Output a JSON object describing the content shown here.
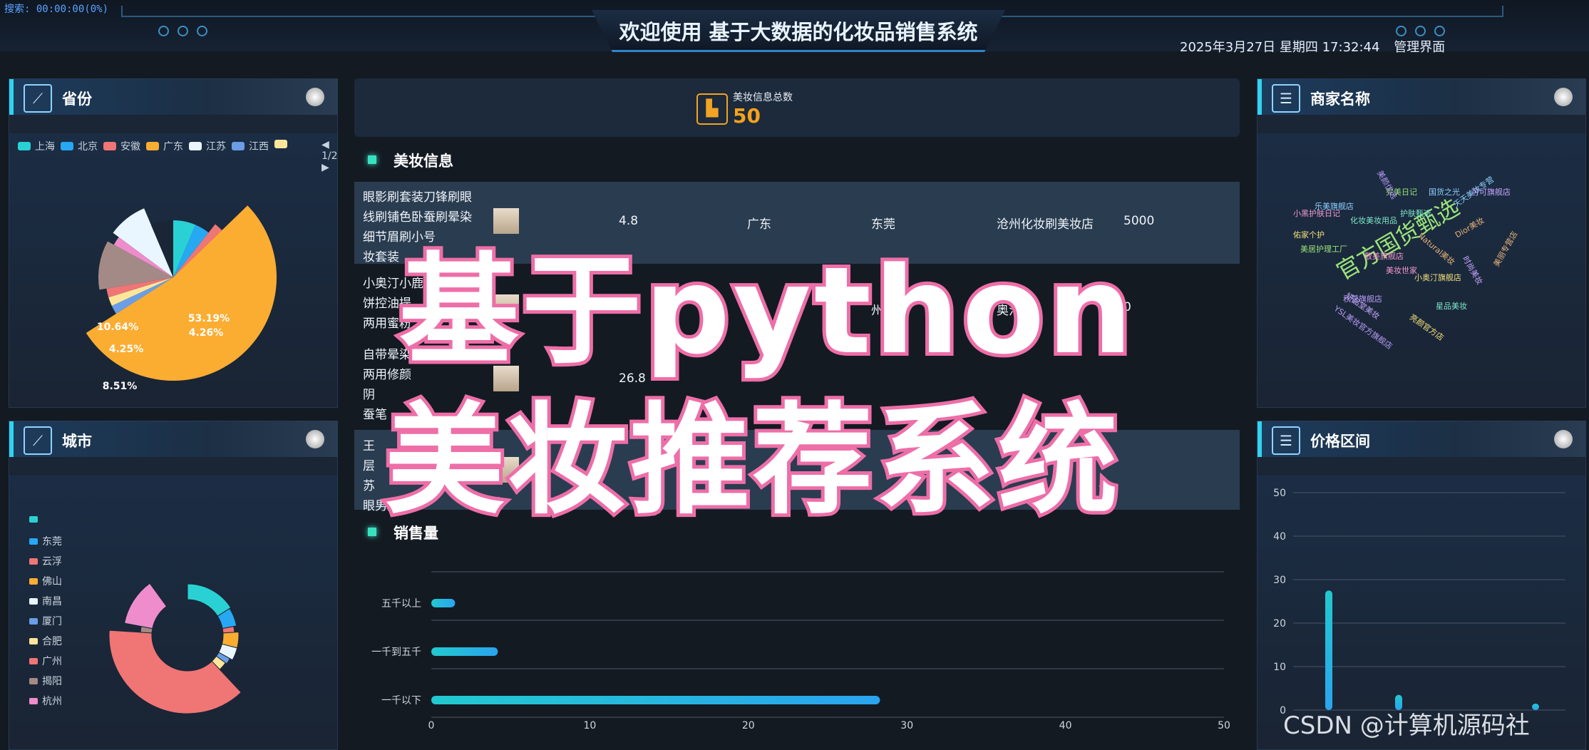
{
  "header": {
    "search_text": "搜索: 00:00:00(0%)",
    "title": "欢迎使用 基于大数据的化妆品销售系统",
    "datetime": "2025年3月27日 星期四 17:32:44",
    "admin_link": "管理界面"
  },
  "province_panel": {
    "title": "省份",
    "legend": [
      {
        "name": "上海",
        "color": "#2ad1d4"
      },
      {
        "name": "北京",
        "color": "#27a8f3"
      },
      {
        "name": "安徽",
        "color": "#f07575"
      },
      {
        "name": "广东",
        "color": "#fbad32"
      },
      {
        "name": "江苏",
        "color": "#eaf6ff"
      },
      {
        "name": "江西",
        "color": "#6a9ee6"
      },
      {
        "name": "",
        "color": "#fde69a"
      }
    ],
    "pager": "1/2",
    "slices": [
      {
        "name": "上海",
        "pct": 6.38,
        "color": "#2ad1d4"
      },
      {
        "name": "北京",
        "pct": 4.26,
        "color": "#27a8f3"
      },
      {
        "name": "安徽",
        "pct": 2.13,
        "color": "#f07575"
      },
      {
        "name": "广东",
        "pct": 53.19,
        "color": "#fbad32"
      },
      {
        "name": "江西",
        "pct": 2.13,
        "color": "#6a9ee6"
      },
      {
        "name": "",
        "pct": 2.13,
        "color": "#fde69a"
      },
      {
        "name": "",
        "pct": 2.13,
        "color": "#f07575"
      },
      {
        "name": "",
        "pct": 10.64,
        "color": "#a48a86"
      },
      {
        "name": "",
        "pct": 2.13,
        "color": "#ee8ccc"
      },
      {
        "name": "江苏",
        "pct": 8.51,
        "color": "#eaf6ff"
      },
      {
        "name": "",
        "pct": 6.37,
        "color": "#1a2535"
      }
    ],
    "labels": [
      "53.19%",
      "10.64%",
      "4.26%",
      "4.25%",
      "8.51%"
    ]
  },
  "city_panel": {
    "title": "城市",
    "legend": [
      {
        "name": "",
        "color": "#2ad1d4"
      },
      {
        "name": "东莞",
        "color": "#27a8f3"
      },
      {
        "name": "云浮",
        "color": "#f07575"
      },
      {
        "name": "佛山",
        "color": "#fbad32"
      },
      {
        "name": "南昌",
        "color": "#eaf6ff"
      },
      {
        "name": "厦门",
        "color": "#6a9ee6"
      },
      {
        "name": "合肥",
        "color": "#fde69a"
      },
      {
        "name": "广州",
        "color": "#f07575"
      },
      {
        "name": "揭阳",
        "color": "#a48a86"
      },
      {
        "name": "杭州",
        "color": "#ee8ccc"
      }
    ]
  },
  "kpi": {
    "label": "美妆信息总数",
    "value": "50"
  },
  "beauty_section": {
    "title": "美妆信息",
    "rows": [
      {
        "lines": [
          "眼影刷套装刀锋刷眼",
          "线刷铺色卧蚕刷晕染",
          "细节眉刷小号",
          "妆套装"
        ],
        "score": "4.8",
        "province": "广东",
        "city": "东莞",
        "shop": "沧州化妆刷美妆店",
        "sales": "5000"
      },
      {
        "lines": [
          "小奥汀小鹿盒",
          "饼控油提",
          "两用蜜粉"
        ],
        "score": "",
        "province": "",
        "city": "州",
        "shop": "奥汀",
        "sales": "0"
      },
      {
        "lines": [
          "自带晕染显",
          "两用修颜",
          "阴",
          "蚕笔"
        ],
        "score": "26.8",
        "province": "",
        "city": "",
        "shop": "",
        "sales": ""
      },
      {
        "lines": [
          "王",
          "层",
          "苏",
          "眼男女"
        ],
        "score": "",
        "province": "",
        "city": "",
        "shop": "",
        "sales": ""
      }
    ]
  },
  "sales_section": {
    "title": "销售量"
  },
  "sales_chart": {
    "chart_data": {
      "type": "bar",
      "categories": [
        "五千以上",
        "一千到五千",
        "一千以下"
      ],
      "values": [
        1.5,
        4.2,
        28.3
      ],
      "xlim": [
        0,
        50
      ],
      "xticks": [
        "0",
        "10",
        "20",
        "30",
        "40",
        "50"
      ]
    }
  },
  "shop_panel": {
    "title": "商家名称",
    "words": [
      "官方国货甄选",
      "秋萱旗舰店",
      "小黑护肤日记",
      "乐美旗舰店",
      "佑家个护",
      "化妆美妆用品",
      "妍品堂美妆",
      "Natural美妆",
      "美居护理工厂",
      "YSL美妆官方旗舰店",
      "敬美旗舰店",
      "天天美妆专营",
      "小奥汀旗舰店",
      "护肤甄选",
      "可可旗舰店",
      "Dior美妆",
      "完美日记",
      "美颜优选",
      "美妆世家",
      "国货之光",
      "亮颜官方店",
      "星品美妆",
      "时尚美妆",
      "美丽专营店"
    ]
  },
  "price_panel": {
    "title": "价格区间",
    "chart_data": {
      "type": "bar",
      "yticks": [
        "0",
        "10",
        "20",
        "30",
        "40",
        "50"
      ],
      "ylim": [
        0,
        50
      ],
      "values": [
        27.5,
        3.5,
        1.5
      ]
    }
  },
  "overlay": {
    "line1": "基于python",
    "line2": "美妆推荐系统"
  },
  "watermark": "CSDN @计算机源码社",
  "colors": {
    "accent": "#32d2f2",
    "orange": "#f7a21a",
    "pink": "#ee6ea8"
  }
}
